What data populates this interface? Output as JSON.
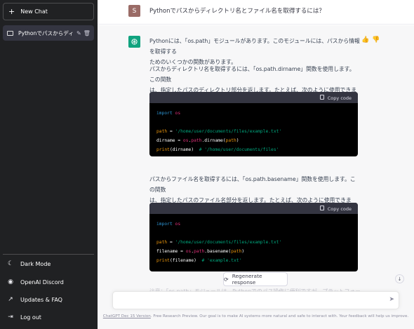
{
  "sidebar": {
    "new_chat": "New Chat",
    "chat_title": "Pythonでパスからディレクト",
    "links": [
      {
        "label": "Dark Mode",
        "icon": "moon-icon"
      },
      {
        "label": "OpenAI Discord",
        "icon": "discord-icon"
      },
      {
        "label": "Updates & FAQ",
        "icon": "external-link-icon"
      },
      {
        "label": "Log out",
        "icon": "logout-icon"
      }
    ]
  },
  "conversation": {
    "user_initial": "S",
    "user_message": "Pythonでパスからディレクトリ名とファイル名を取得するには？",
    "para1_line1": "Pythonには、「os.path」モジュールがあります。このモジュールには、パスから情報を取得する",
    "para1_line2": "ためのいくつかの関数があります。",
    "para2_line1": "パスからディレクトリ名を取得するには、「os.path.dirname」関数を使用します。この関数",
    "para2_line2": "は、指定したパスのディレクトリ部分を返します。たとえば、次のように使用できます。",
    "para3_line1": "パスからファイル名を取得するには、「os.path.basename」関数を使用します。この関数",
    "para3_line2": "は、指定したパスのファイル名部分を返します。たとえば、次のように使用できます。",
    "copy_code": "Copy code",
    "code1": {
      "import_kw": "import",
      "import_mod": "os",
      "path_var": "path",
      "path_str": "'/home/user/documents/files/example.txt'",
      "dirname_var": "dirname",
      "dirname_os": "os",
      "dirname_path": "path",
      "dirname_fn": "dirname",
      "dirname_arg": "path",
      "print_fn": "print",
      "print_arg": "dirname",
      "print_comment": "# '/home/user/documents/files'"
    },
    "code2": {
      "import_kw": "import",
      "import_mod": "os",
      "path_var": "path",
      "path_str": "'/home/user/documents/files/example.txt'",
      "filename_var": "filename",
      "filename_os": "os",
      "filename_path": "path",
      "filename_fn": "basename",
      "filename_arg": "path",
      "print_fn": "print",
      "print_arg": "filename",
      "print_comment": "# 'example.txt'"
    },
    "faded_text": "注意：「os.path」モジュールは、Pythonでのパス操作に便利ですが、プラットフォームによって"
  },
  "controls": {
    "regenerate": "Regenerate response",
    "input_placeholder": ""
  },
  "footer": {
    "version_link": "ChatGPT Dec 15 Version",
    "text": ". Free Research Preview. Our goal is to make AI systems more natural and safe to interact with. Your feedback will help us improve."
  },
  "colors": {
    "sidebar_bg": "#202123",
    "accent": "#10a37f",
    "user_avatar": "#9a6b66"
  }
}
